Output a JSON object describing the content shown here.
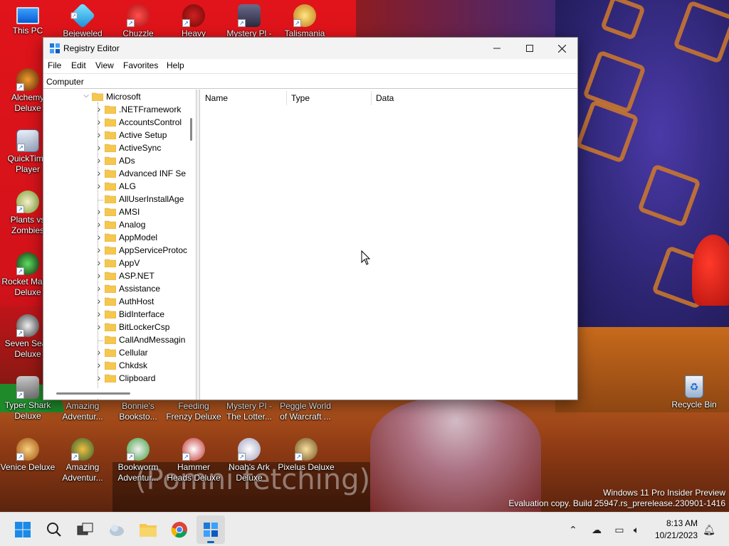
{
  "desktop": {
    "icons": [
      {
        "label": "This PC"
      },
      {
        "label": "Bejeweled"
      },
      {
        "label": "Chuzzle"
      },
      {
        "label": "Heavy"
      },
      {
        "label": "Mystery Pl -"
      },
      {
        "label": "Talismania"
      },
      {
        "label": "Alchemy Deluxe"
      },
      {
        "label": "QuickTime Player"
      },
      {
        "label": "Plants vs Zombies"
      },
      {
        "label": "Rocket Mania Deluxe"
      },
      {
        "label": "Seven Seas Deluxe"
      },
      {
        "label": "Typer Shark Deluxe"
      },
      {
        "label": "Amazing Adventur..."
      },
      {
        "label": "Bonnie's Booksto..."
      },
      {
        "label": "Feeding Frenzy Deluxe"
      },
      {
        "label": "Mystery PI - The Lotter..."
      },
      {
        "label": "Peggle World of Warcraft ..."
      },
      {
        "label": "Venice Deluxe"
      },
      {
        "label": "Amazing Adventur..."
      },
      {
        "label": "Bookworm Adventur..."
      },
      {
        "label": "Hammer Heads Deluxe"
      },
      {
        "label": "Noah's Ark Deluxe"
      },
      {
        "label": "Pixelus Deluxe"
      },
      {
        "label": "Recycle Bin"
      }
    ],
    "wallpaper_subtitle": "(Pomni fetching)"
  },
  "window": {
    "title": "Registry Editor",
    "menu": [
      "File",
      "Edit",
      "View",
      "Favorites",
      "Help"
    ],
    "address": "Computer",
    "tree": {
      "parent": "Microsoft",
      "items": [
        {
          "name": ".NETFramework",
          "expandable": true
        },
        {
          "name": "AccountsControl",
          "expandable": true
        },
        {
          "name": "Active Setup",
          "expandable": true
        },
        {
          "name": "ActiveSync",
          "expandable": true
        },
        {
          "name": "ADs",
          "expandable": true
        },
        {
          "name": "Advanced INF Se",
          "expandable": true
        },
        {
          "name": "ALG",
          "expandable": true
        },
        {
          "name": "AllUserInstallAge",
          "expandable": false
        },
        {
          "name": "AMSI",
          "expandable": true
        },
        {
          "name": "Analog",
          "expandable": true
        },
        {
          "name": "AppModel",
          "expandable": true
        },
        {
          "name": "AppServiceProtoc",
          "expandable": true
        },
        {
          "name": "AppV",
          "expandable": true
        },
        {
          "name": "ASP.NET",
          "expandable": true
        },
        {
          "name": "Assistance",
          "expandable": true
        },
        {
          "name": "AuthHost",
          "expandable": true
        },
        {
          "name": "BidInterface",
          "expandable": true
        },
        {
          "name": "BitLockerCsp",
          "expandable": true
        },
        {
          "name": "CallAndMessagin",
          "expandable": false
        },
        {
          "name": "Cellular",
          "expandable": true
        },
        {
          "name": "Chkdsk",
          "expandable": true
        },
        {
          "name": "Clipboard",
          "expandable": true
        }
      ]
    },
    "columns": [
      "Name",
      "Type",
      "Data"
    ]
  },
  "watermark": {
    "line1": "Windows 11 Pro Insider Preview",
    "line2": "Evaluation copy. Build 25947.rs_prerelease.230901-1416"
  },
  "taskbar": {
    "time": "8:13 AM",
    "date": "10/21/2023"
  },
  "colors": {
    "accent": "#0067c0",
    "folder": "#f5c74f",
    "taskbar": "#ececec"
  }
}
